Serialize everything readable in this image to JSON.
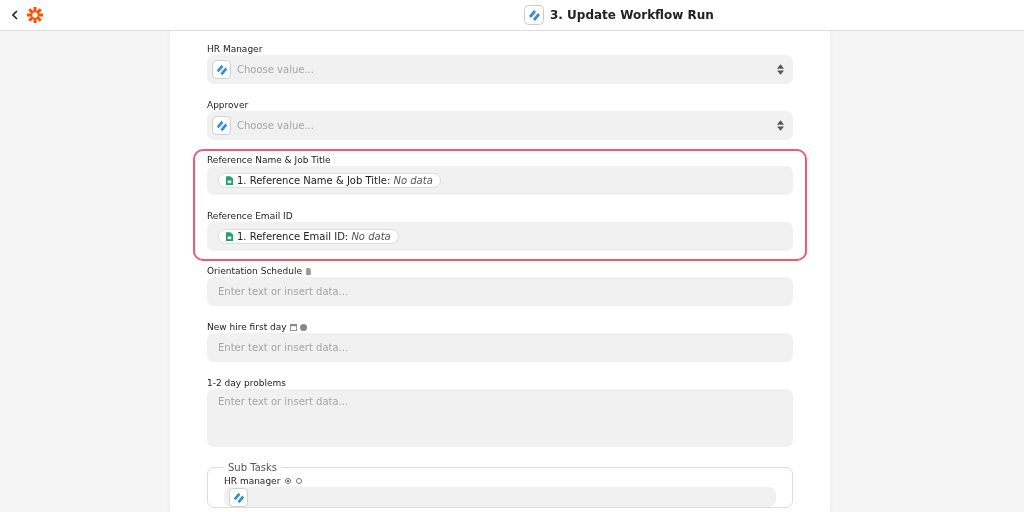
{
  "header": {
    "title": "3. Update Workflow Run"
  },
  "sections": [
    {
      "highlighted": false,
      "fields": [
        {
          "label": "HR Manager",
          "kind": "select",
          "placeholder": "Choose value..."
        },
        {
          "label": "Approver",
          "kind": "select",
          "placeholder": "Choose value..."
        }
      ]
    },
    {
      "highlighted": true,
      "fields": [
        {
          "label": "Reference Name & Job Title",
          "kind": "mapped",
          "pill": "1. Reference Name & Job Title:",
          "pill_value": "No data"
        },
        {
          "label": "Reference Email ID",
          "kind": "mapped",
          "pill": "1. Reference Email ID:",
          "pill_value": "No data"
        }
      ]
    },
    {
      "highlighted": false,
      "fields": [
        {
          "label": "Orientation Schedule",
          "kind": "file",
          "placeholder": "Enter text or insert data..."
        },
        {
          "label": "New hire first day",
          "kind": "date",
          "placeholder": "Enter text or insert data..."
        },
        {
          "label": "1-2 day problems",
          "kind": "textarea",
          "placeholder": "Enter text or insert data..."
        }
      ]
    }
  ],
  "sub_tasks": {
    "legend": "Sub Tasks",
    "field_label": "HR manager",
    "radios": [
      {
        "selected": true
      },
      {
        "selected": false
      }
    ]
  }
}
